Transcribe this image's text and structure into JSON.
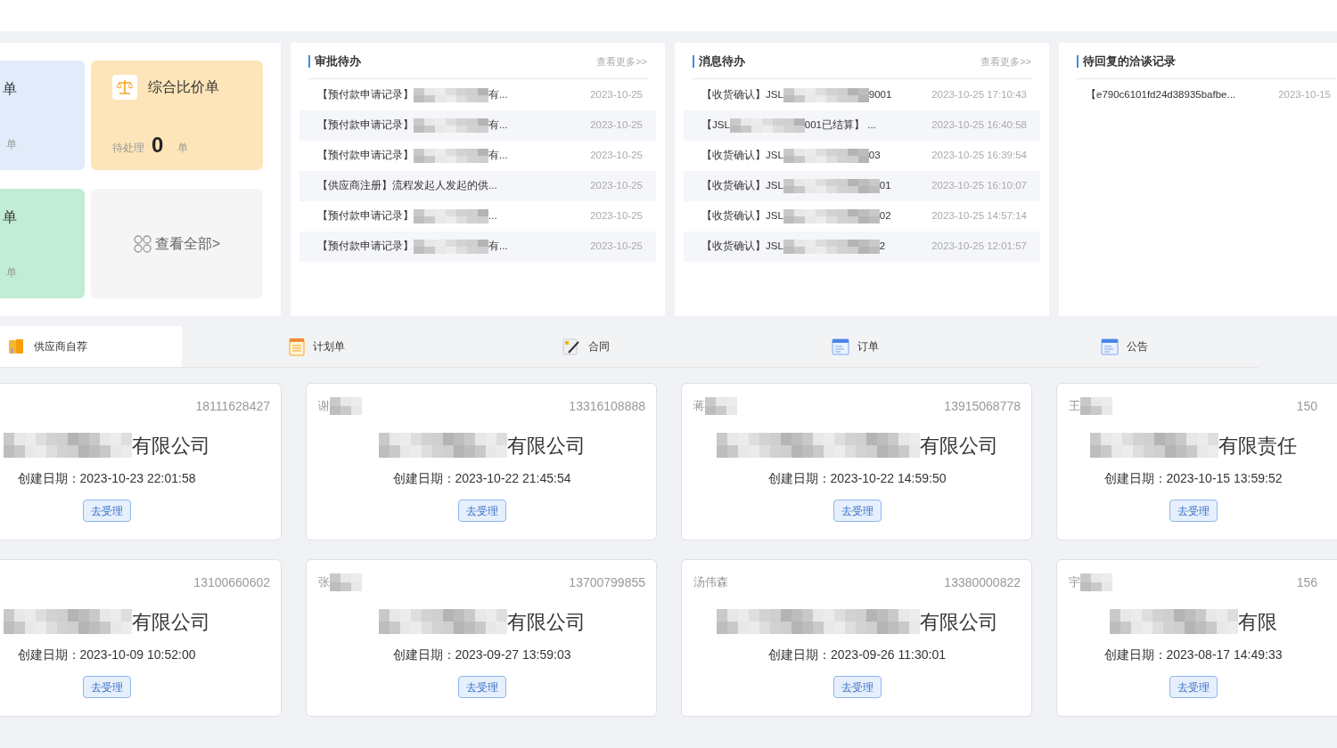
{
  "summary_cards": [
    {
      "kind": "partial",
      "color": "#e1ebfa",
      "title": "单",
      "unit": "单"
    },
    {
      "kind": "full",
      "color": "#fde5b9",
      "title": "综合比价单",
      "label": "待处理",
      "count": "0",
      "unit": "单"
    },
    {
      "kind": "partial",
      "color": "#c1ecd5",
      "title": "单",
      "unit": "单"
    },
    {
      "kind": "view_all",
      "color": "#f5f5f5",
      "title": "查看全部>"
    }
  ],
  "panels": [
    {
      "title": "审批待办",
      "more": "查看更多>>",
      "rows": [
        {
          "prefix": "【预付款申请记录】",
          "masked": true,
          "suffix": "有...",
          "time": "2023-10-25"
        },
        {
          "prefix": "【预付款申请记录】",
          "masked": true,
          "suffix": "有...",
          "time": "2023-10-25"
        },
        {
          "prefix": "【预付款申请记录】",
          "masked": true,
          "suffix": "有...",
          "time": "2023-10-25"
        },
        {
          "prefix": "【供应商注册】流程发起人发起的供...",
          "masked": false,
          "time": "2023-10-25"
        },
        {
          "prefix": "【预付款申请记录】",
          "masked": true,
          "suffix": "...",
          "time": "2023-10-25"
        },
        {
          "prefix": "【预付款申请记录】",
          "masked": true,
          "suffix": "有...",
          "time": "2023-10-25"
        }
      ]
    },
    {
      "title": "消息待办",
      "more": "查看更多>>",
      "rows": [
        {
          "prefix": "【收货确认】JSL",
          "masked": true,
          "suffix": "9001",
          "time": "2023-10-25 17:10:43"
        },
        {
          "prefix": "【JSL",
          "masked": true,
          "suffix": "001已结算】 ...",
          "time": "2023-10-25 16:40:58"
        },
        {
          "prefix": "【收货确认】JSL",
          "masked": true,
          "suffix": "03",
          "time": "2023-10-25 16:39:54"
        },
        {
          "prefix": "【收货确认】JSL",
          "masked": true,
          "suffix": "01",
          "time": "2023-10-25 16:10:07"
        },
        {
          "prefix": "【收货确认】JSL",
          "masked": true,
          "suffix": "02",
          "time": "2023-10-25 14:57:14"
        },
        {
          "prefix": "【收货确认】JSL",
          "masked": true,
          "suffix": "2",
          "time": "2023-10-25 12:01:57"
        }
      ]
    },
    {
      "title": "待回复的洽谈记录",
      "rows": [
        {
          "prefix": "【e790c6101fd24d38935bafbe...",
          "masked": false,
          "time": "2023-10-15"
        }
      ]
    }
  ],
  "tabs": [
    {
      "label": "供应商自荐",
      "kind": "book",
      "selected": true
    },
    {
      "label": "计划单",
      "kind": "notepad",
      "selected": false
    },
    {
      "label": "合同",
      "kind": "pen",
      "selected": false
    },
    {
      "label": "订单",
      "kind": "form",
      "selected": false
    },
    {
      "label": "公告",
      "kind": "form",
      "selected": false
    }
  ],
  "suppliers": [
    {
      "phone": "18111628427",
      "company": "有限公司",
      "date_label": "创建日期：",
      "date": "2023-10-23 22:01:58",
      "button": "去受理"
    },
    {
      "name": "谢",
      "masked": true,
      "phone": "13316108888",
      "company": "有限公司",
      "date_label": "创建日期：",
      "date": "2023-10-22 21:45:54",
      "button": "去受理"
    },
    {
      "name": "蒋",
      "masked": true,
      "phone": "13915068778",
      "company": "有限公司",
      "date_label": "创建日期：",
      "date": "2023-10-22 14:59:50",
      "button": "去受理"
    },
    {
      "name": "王",
      "masked": true,
      "phone": "150",
      "company": "有限责任",
      "date_label": "创建日期：",
      "date": "2023-10-15 13:59:52",
      "button": "去受理"
    },
    {
      "phone": "13100660602",
      "company": "有限公司",
      "date_label": "创建日期：",
      "date": "2023-10-09 10:52:00",
      "button": "去受理"
    },
    {
      "name": "张",
      "masked": true,
      "phone": "13700799855",
      "company": "有限公司",
      "date_label": "创建日期：",
      "date": "2023-09-27 13:59:03",
      "button": "去受理"
    },
    {
      "name": "汤伟森",
      "masked": false,
      "phone": "13380000822",
      "company": "有限公司",
      "date_label": "创建日期：",
      "date": "2023-09-26 11:30:01",
      "button": "去受理"
    },
    {
      "name": "宇",
      "masked": true,
      "phone": "156",
      "company": "有限",
      "date_label": "创建日期：",
      "date": "2023-08-17 14:49:33",
      "button": "去受理"
    }
  ]
}
